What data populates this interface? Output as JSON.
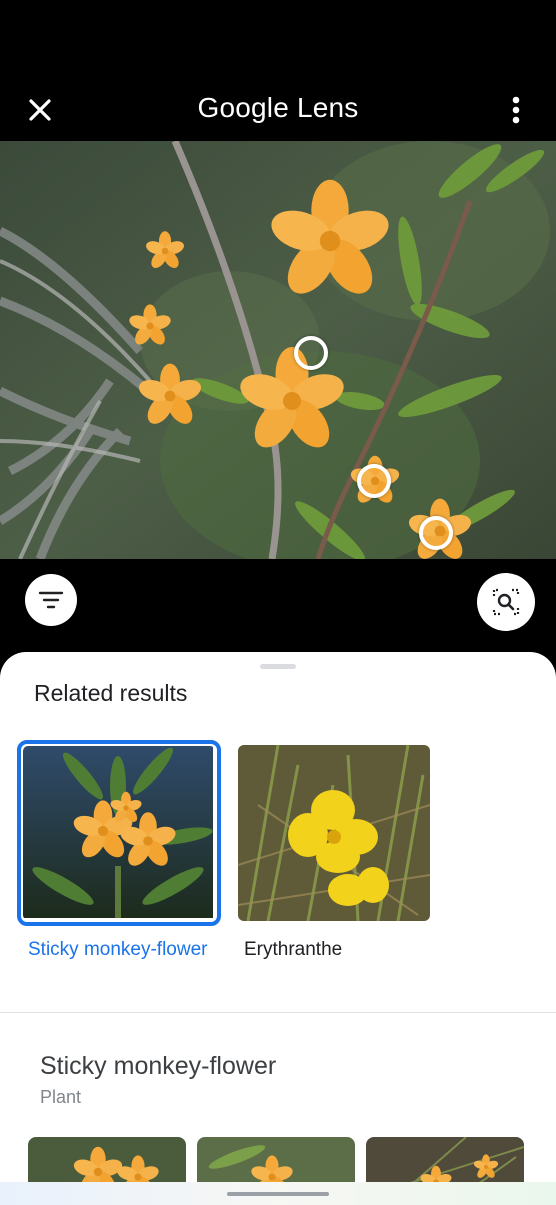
{
  "app": {
    "title": "Google Lens"
  },
  "toolbar": {
    "close_icon": "close-icon",
    "more_icon": "more-vert-icon"
  },
  "controls": {
    "filter_icon": "filter-icon",
    "select_icon": "image-search-icon"
  },
  "related": {
    "title": "Related results",
    "items": [
      {
        "label": "Sticky monkey-flower",
        "selected": true
      },
      {
        "label": "Erythranthe",
        "selected": false
      }
    ]
  },
  "entity": {
    "title": "Sticky monkey-flower",
    "subtitle": "Plant"
  },
  "colors": {
    "accent": "#1a73e8",
    "flower_orange": "#f5a623",
    "flower_yellow": "#f2d21b"
  }
}
